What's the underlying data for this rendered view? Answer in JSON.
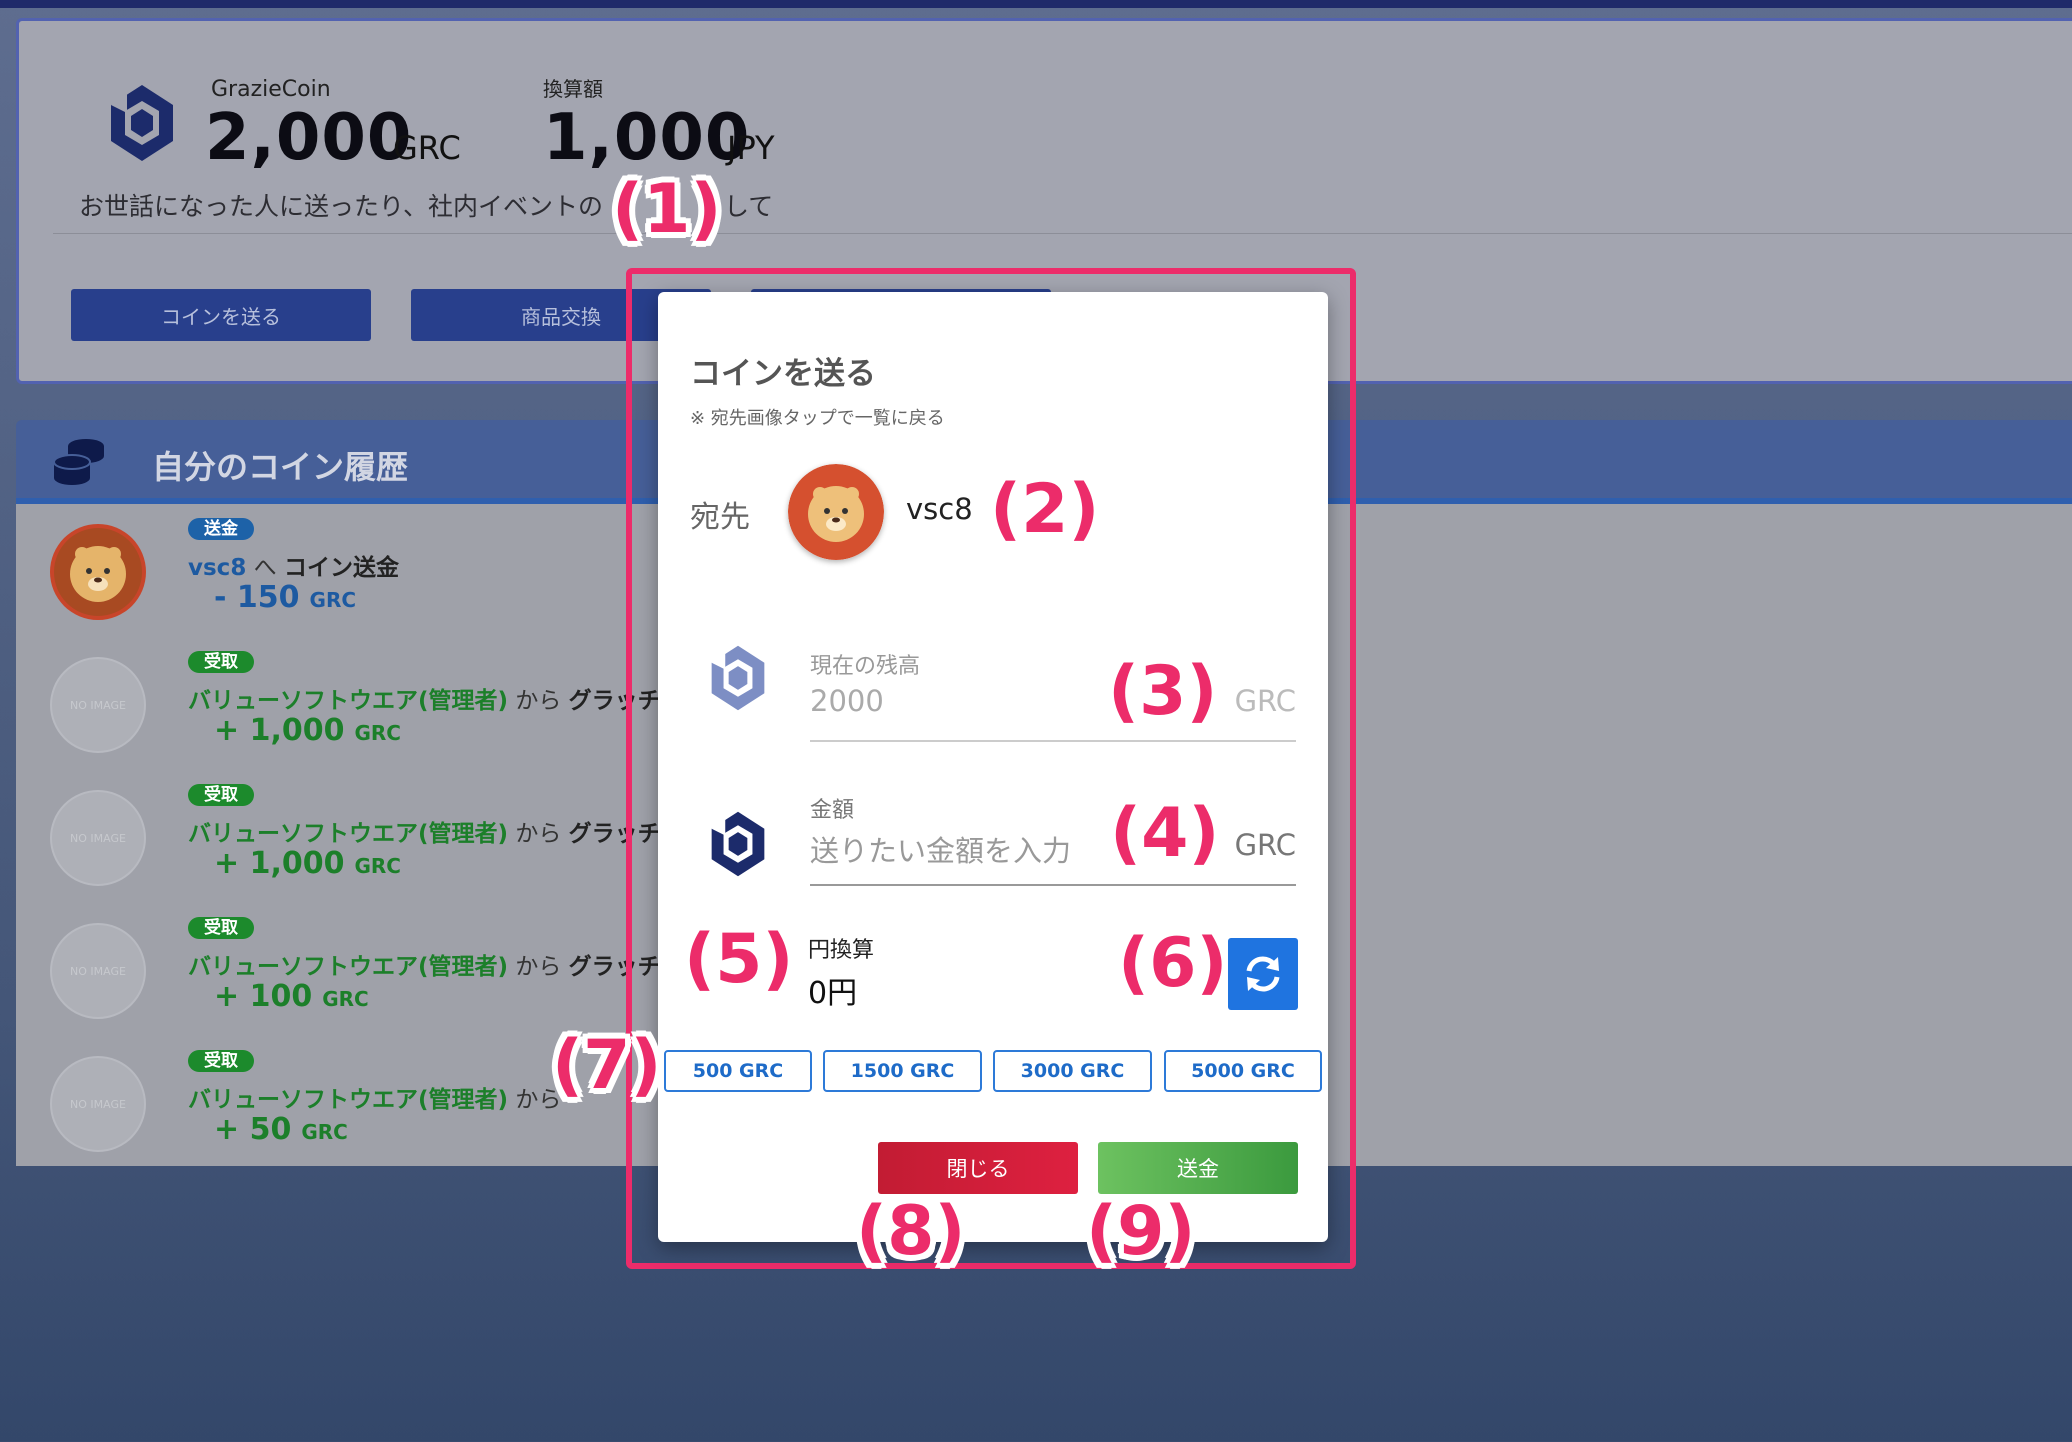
{
  "balance": {
    "coin_name": "GrazieCoin",
    "coin_amount": "2,000",
    "coin_unit": "GRC",
    "convert_label": "換算額",
    "convert_amount": "1,000",
    "convert_unit": "JPY",
    "description": "お世話になった人に送ったり、社内イベントの",
    "description_tail": "として",
    "buttons": [
      "コインを送る",
      "商品交換"
    ]
  },
  "history": {
    "title": "自分のコイン履歴",
    "no_image_label": "NO IMAGE",
    "items": [
      {
        "badge": "送金",
        "type": "send",
        "name": "vsc8",
        "connector": "へ",
        "action": "コイン送金",
        "amount": "- 150",
        "unit": "GRC"
      },
      {
        "badge": "受取",
        "type": "recv",
        "name": "バリューソフトウエア(管理者)",
        "connector": "から",
        "action": "グラッチ",
        "amount": "+ 1,000",
        "unit": "GRC"
      },
      {
        "badge": "受取",
        "type": "recv",
        "name": "バリューソフトウエア(管理者)",
        "connector": "から",
        "action": "グラッチ",
        "amount": "+ 1,000",
        "unit": "GRC"
      },
      {
        "badge": "受取",
        "type": "recv",
        "name": "バリューソフトウエア(管理者)",
        "connector": "から",
        "action": "グラッチ",
        "amount": "+ 100",
        "unit": "GRC"
      },
      {
        "badge": "受取",
        "type": "recv",
        "name": "バリューソフトウエア(管理者)",
        "connector": "から",
        "action": "",
        "amount": "+ 50",
        "unit": "GRC"
      }
    ]
  },
  "modal": {
    "title": "コインを送る",
    "note": "※ 宛先画像タップで一覧に戻る",
    "dest_label": "宛先",
    "dest_name": "vsc8",
    "balance_label": "現在の残高",
    "balance_value": "2000",
    "balance_unit": "GRC",
    "amount_label": "金額",
    "amount_placeholder": "送りたい金額を入力",
    "amount_unit": "GRC",
    "yen_label": "円換算",
    "yen_value": "0円",
    "presets": [
      "500 GRC",
      "1500 GRC",
      "3000 GRC",
      "5000 GRC"
    ],
    "close_label": "閉じる",
    "send_label": "送金"
  },
  "callouts": [
    "(1)",
    "(2)",
    "(3)",
    "(4)",
    "(5)",
    "(6)",
    "(7)",
    "(8)",
    "(9)"
  ],
  "colors": {
    "accent": "#ec2c6a",
    "primary_button": "#283f8c",
    "send_green": "#3b9a3e",
    "close_red": "#c21c33",
    "refresh_blue": "#1f74e0"
  }
}
